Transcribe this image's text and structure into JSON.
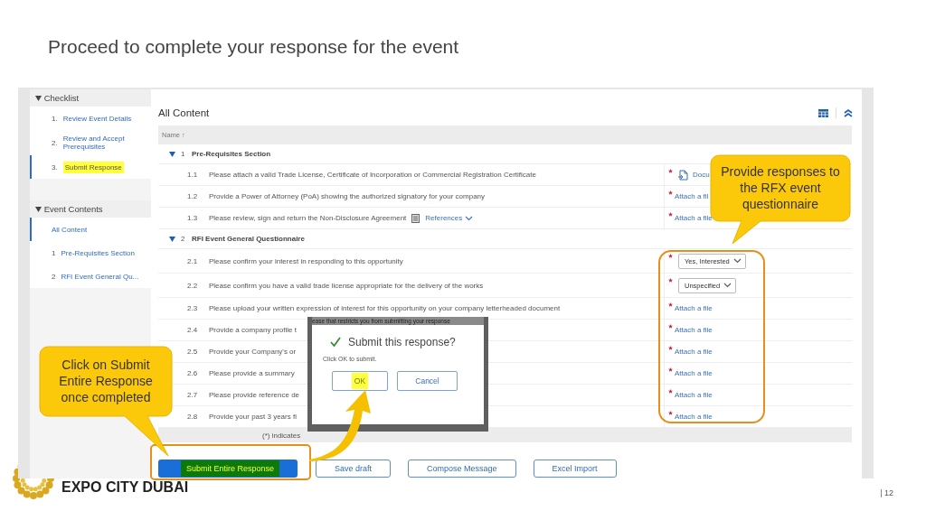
{
  "slide": {
    "title": "Proceed to complete your response for the event",
    "logo_text": "EXPO CITY DUBAI",
    "page_number": "12"
  },
  "sidebar": {
    "groups": [
      {
        "title": "Checklist",
        "expanded": true,
        "items": [
          {
            "number": "1.",
            "label": "Review Event Details",
            "selected": false,
            "highlighted": false
          },
          {
            "number": "2.",
            "label": "Review and Accept Prerequisites",
            "selected": false,
            "highlighted": false
          },
          {
            "number": "3.",
            "label": "Submit Response",
            "selected": true,
            "highlighted": true
          }
        ]
      },
      {
        "title": "Event Contents",
        "expanded": true,
        "items": [
          {
            "label": "All Content",
            "selected": true,
            "highlighted": false
          },
          {
            "number": "1",
            "label": "Pre-Requisites Section",
            "selected": false,
            "highlighted": false
          },
          {
            "number": "2",
            "label": "RFI Event General Qu...",
            "selected": false,
            "highlighted": false
          }
        ]
      }
    ]
  },
  "content": {
    "title": "All Content",
    "column": "Name ↑",
    "sections": [
      {
        "number": "1",
        "title": "Pre-Requisites Section",
        "expanded": true,
        "children": [
          {
            "number": "1.1",
            "text": "Please attach a valid Trade License, Certificate of Incorporation or Commercial Registration Certificate",
            "response": {
              "kind": "document",
              "required": true,
              "label": "Docu"
            }
          },
          {
            "number": "1.2",
            "text": "Provide a Power of Attorney (PoA) showing the authorized signatory for your company",
            "response": {
              "kind": "attachment",
              "required": true,
              "label": "Attach a fil"
            }
          },
          {
            "number": "1.3",
            "text": "Please review, sign and return the Non-Disclosure Agreement",
            "references": "References",
            "response": {
              "kind": "attachment",
              "required": true,
              "label": "Attach a file"
            }
          }
        ]
      },
      {
        "number": "2",
        "title": "RFI Event General Questionnaire",
        "expanded": true,
        "children": [
          {
            "number": "2.1",
            "text": "Please confirm your interest in responding to this opportunity",
            "response": {
              "kind": "dropdown",
              "required": true,
              "label": "Yes, Interested"
            }
          },
          {
            "number": "2.2",
            "text": "Please confirm you have a valid trade license appropriate for the delivery of the works",
            "response": {
              "kind": "dropdown",
              "required": true,
              "label": "Unspecified"
            }
          },
          {
            "number": "2.3",
            "text": "Please upload your written expression of interest for this opportunity on your company letterheaded document",
            "response": {
              "kind": "attachment",
              "required": true,
              "label": "Attach a file"
            }
          },
          {
            "number": "2.4",
            "text": "Provide a company profile t",
            "response": {
              "kind": "attachment",
              "required": true,
              "label": "Attach a file"
            }
          },
          {
            "number": "2.5",
            "text": "Provide your Company's or",
            "response": {
              "kind": "attachment",
              "required": true,
              "label": "Attach a file"
            }
          },
          {
            "number": "2.6",
            "text": "Please provide a summary",
            "response": {
              "kind": "attachment",
              "required": true,
              "label": "Attach a file"
            }
          },
          {
            "number": "2.7",
            "text": "Please provide reference de",
            "response": {
              "kind": "attachment",
              "required": true,
              "label": "Attach a file"
            }
          },
          {
            "number": "2.8",
            "text": "Provide your past 3 years fi",
            "response": {
              "kind": "attachment",
              "required": true,
              "label": "Attach a file"
            }
          }
        ]
      }
    ],
    "footnote": "(*) indicates"
  },
  "dialog": {
    "backdrop_text": "ease that restricts you from submitting your response",
    "title": "Submit this response?",
    "message": "Click OK to submit.",
    "buttons": [
      {
        "label": "OK",
        "highlighted": true
      },
      {
        "label": "Cancel",
        "highlighted": false
      }
    ]
  },
  "buttons": [
    {
      "label": "Submit Entire Response",
      "kind": "primary",
      "highlighted": true
    },
    {
      "label": "Save draft",
      "kind": "secondary",
      "highlighted": false
    },
    {
      "label": "Compose Message",
      "kind": "secondary",
      "highlighted": false
    },
    {
      "label": "Excel Import",
      "kind": "secondary",
      "highlighted": false
    }
  ],
  "callouts": [
    {
      "text": "Provide responses to the RFX event questionnaire",
      "kind": "top"
    },
    {
      "text": "Click on Submit Entire Response once completed",
      "kind": "bottom"
    }
  ]
}
